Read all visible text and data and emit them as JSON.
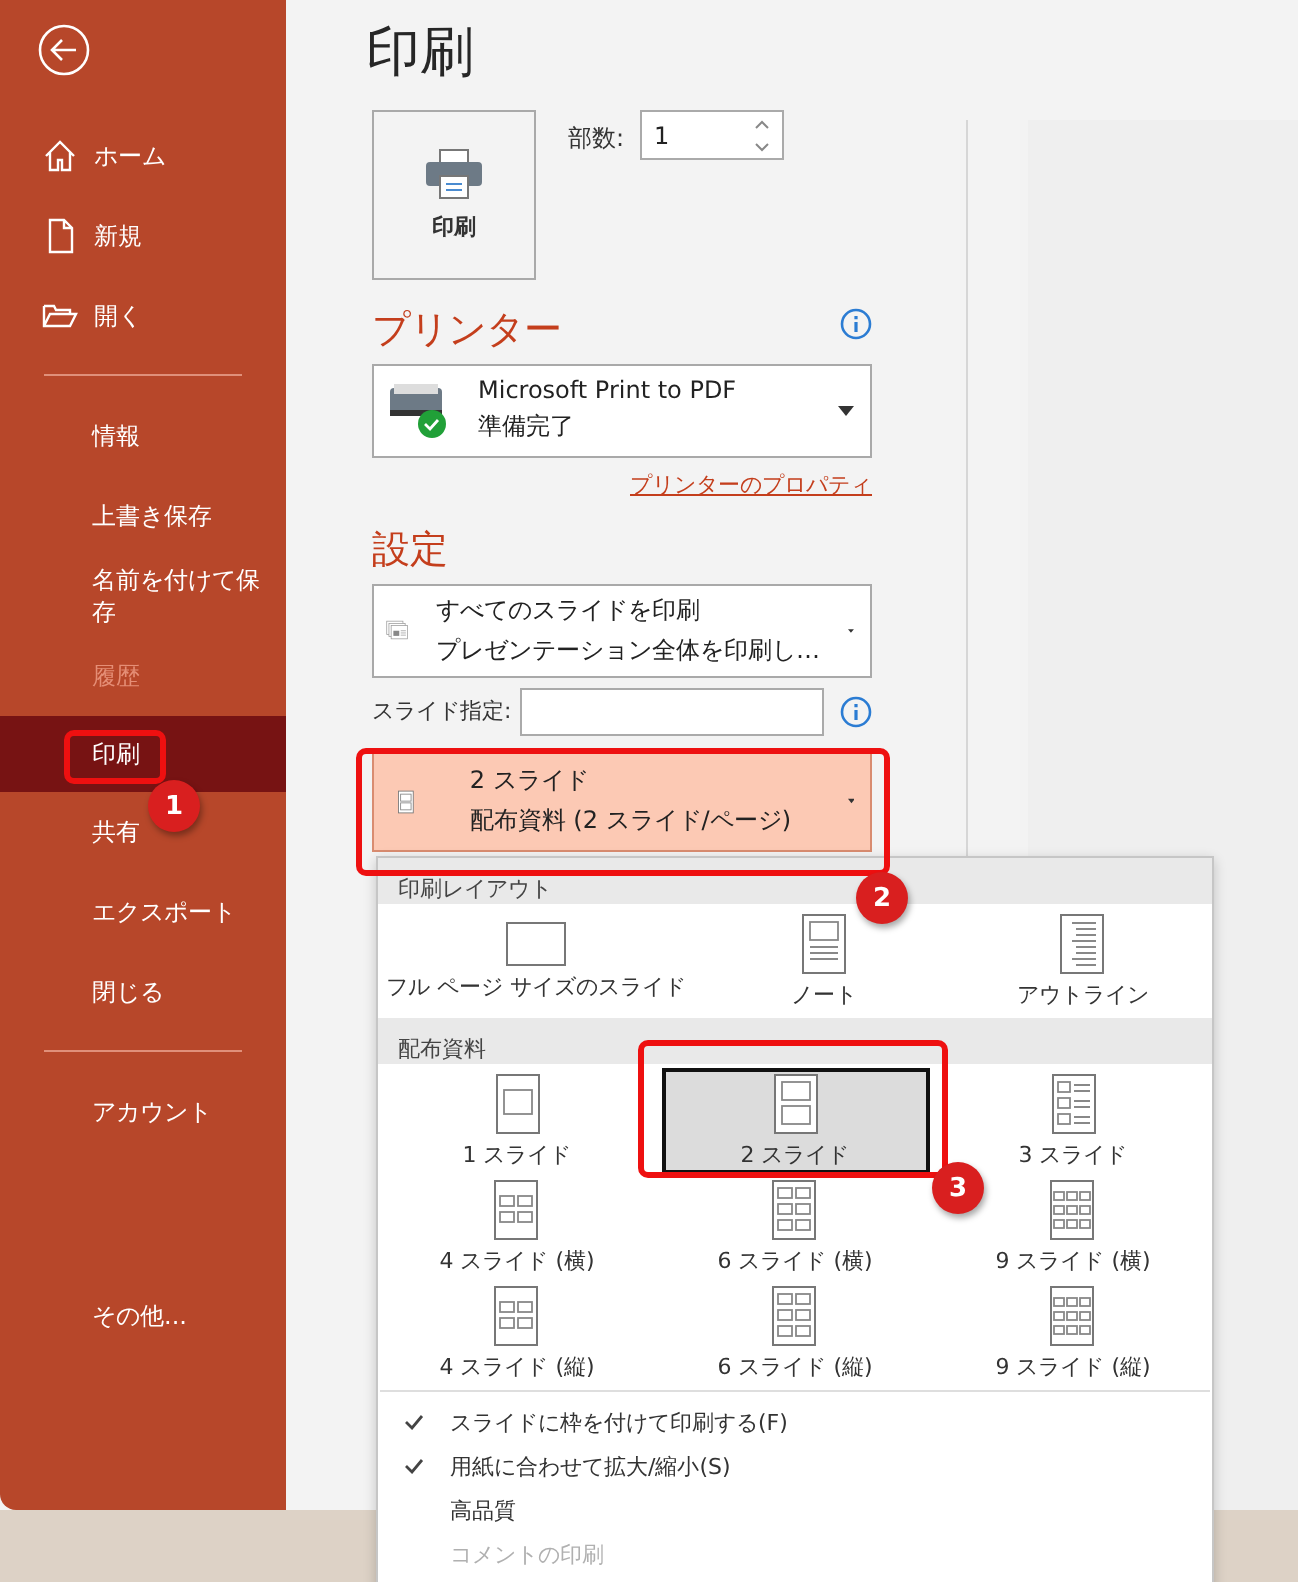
{
  "sidebar": {
    "top_items": [
      {
        "label": "ホーム",
        "selected": false
      },
      {
        "label": "新規",
        "selected": false
      },
      {
        "label": "開く",
        "selected": false
      }
    ],
    "middle_items": [
      {
        "label": "情報",
        "selected": false,
        "disabled": false
      },
      {
        "label": "上書き保存",
        "selected": false,
        "disabled": false
      },
      {
        "label": "名前を付けて保存",
        "selected": false,
        "disabled": false
      },
      {
        "label": "履歴",
        "selected": false,
        "disabled": true
      },
      {
        "label": "印刷",
        "selected": true,
        "disabled": false
      },
      {
        "label": "共有",
        "selected": false,
        "disabled": false
      },
      {
        "label": "エクスポート",
        "selected": false,
        "disabled": false
      },
      {
        "label": "閉じる",
        "selected": false,
        "disabled": false
      }
    ],
    "bottom_items": [
      {
        "label": "アカウント",
        "selected": false
      },
      {
        "label": "その他...",
        "selected": false
      }
    ]
  },
  "main": {
    "title": "印刷",
    "print_button": "印刷",
    "copies": {
      "label": "部数:",
      "value": "1"
    },
    "printer": {
      "heading": "プリンター",
      "name": "Microsoft Print to PDF",
      "status": "準備完了",
      "properties_link": "プリンターのプロパティ"
    },
    "settings": {
      "heading": "設定",
      "slides_dropdown": {
        "title": "すべてのスライドを印刷",
        "subtitle": "プレゼンテーション全体を印刷し…"
      },
      "slide_range": {
        "label": "スライド指定:"
      },
      "layout_dropdown": {
        "title": "2 スライド",
        "subtitle": "配布資料 (2 スライド/ページ)",
        "open": true
      }
    }
  },
  "layout_menu": {
    "sections": [
      {
        "heading": "印刷レイアウト",
        "items": [
          {
            "label": "フル ページ サイズのスライド",
            "kind": "full",
            "selected": false
          },
          {
            "label": "ノート",
            "kind": "notes",
            "selected": false
          },
          {
            "label": "アウトライン",
            "kind": "outline",
            "selected": false
          }
        ]
      },
      {
        "heading": "配布資料",
        "items": [
          {
            "label": "1 スライド",
            "kind": "h1",
            "selected": false
          },
          {
            "label": "2 スライド",
            "kind": "h2",
            "selected": true
          },
          {
            "label": "3 スライド",
            "kind": "h3",
            "selected": false
          },
          {
            "label": "4 スライド (横)",
            "kind": "h4",
            "selected": false
          },
          {
            "label": "6 スライド (横)",
            "kind": "h6",
            "selected": false
          },
          {
            "label": "9 スライド (横)",
            "kind": "h9",
            "selected": false
          },
          {
            "label": "4 スライド (縦)",
            "kind": "h4",
            "selected": false
          },
          {
            "label": "6 スライド (縦)",
            "kind": "h6",
            "selected": false
          },
          {
            "label": "9 スライド (縦)",
            "kind": "h9",
            "selected": false
          }
        ]
      }
    ],
    "options": [
      {
        "label": "スライドに枠を付けて印刷する(F)",
        "checked": true,
        "disabled": false
      },
      {
        "label": "用紙に合わせて拡大/縮小(S)",
        "checked": true,
        "disabled": false
      },
      {
        "label": "高品質",
        "checked": false,
        "disabled": false
      },
      {
        "label": "コメントの印刷",
        "checked": false,
        "disabled": true
      }
    ]
  },
  "callouts": [
    {
      "label": "1"
    },
    {
      "label": "2"
    },
    {
      "label": "3"
    }
  ]
}
